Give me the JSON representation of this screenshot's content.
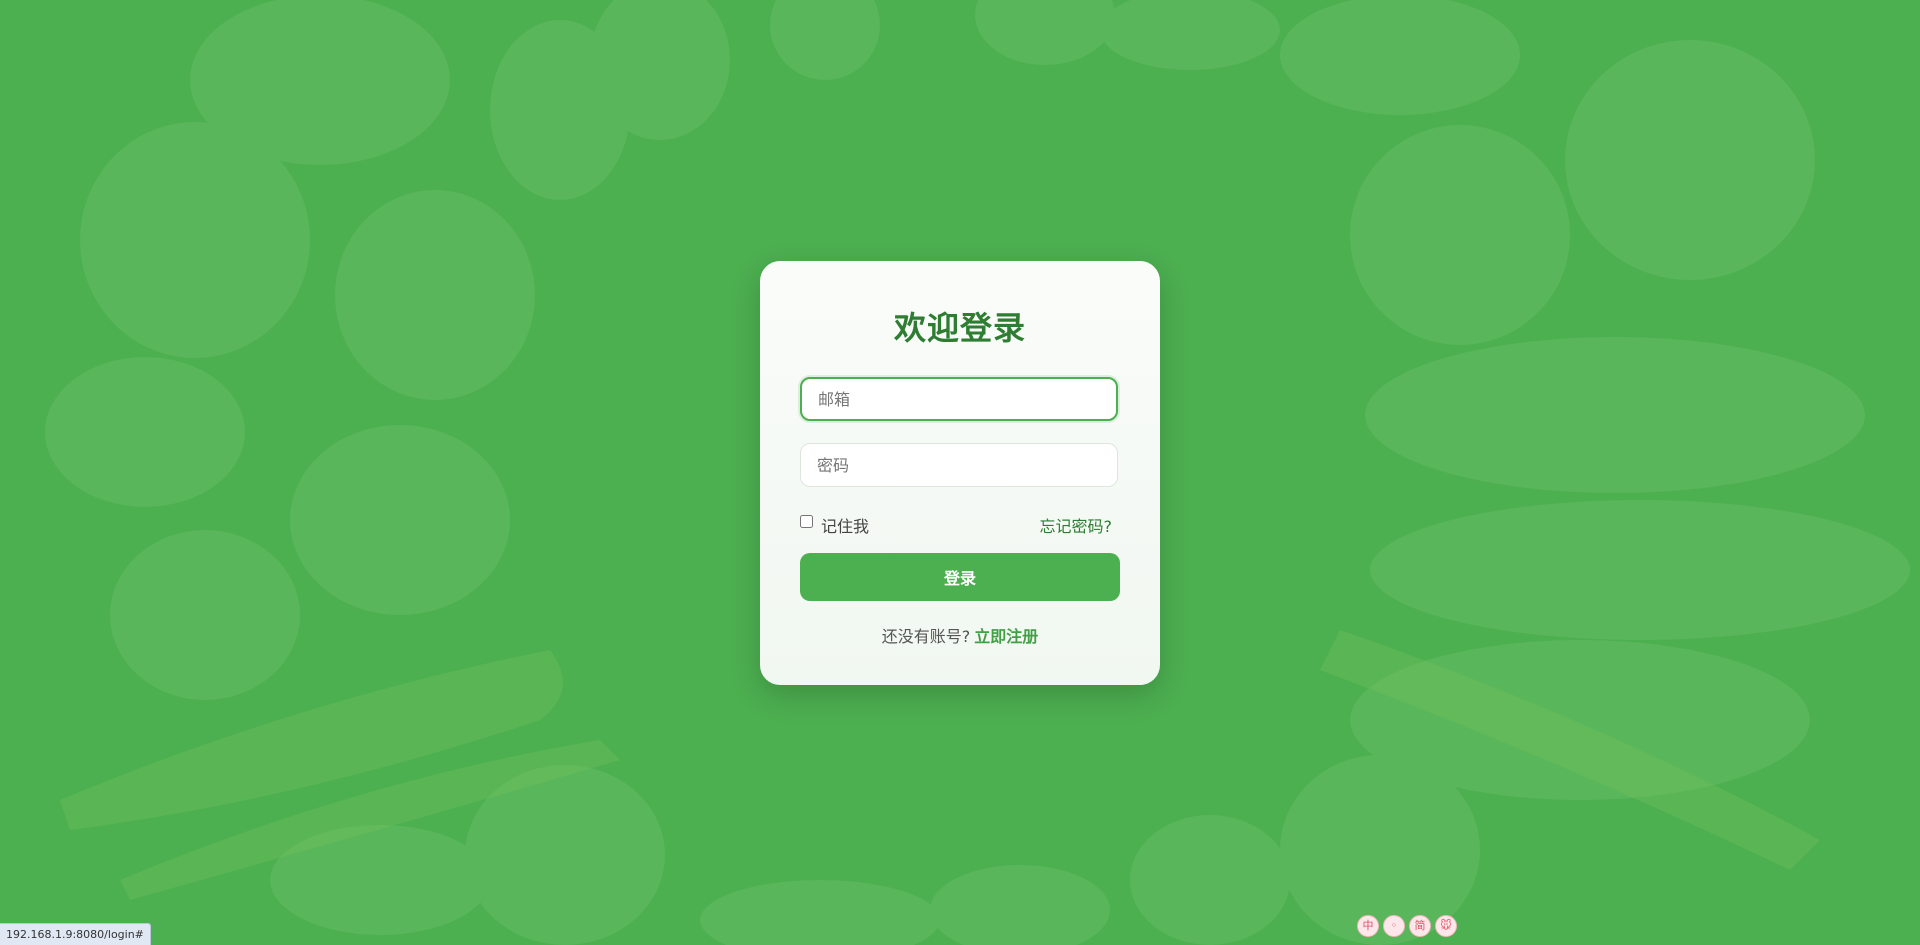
{
  "login": {
    "title": "欢迎登录",
    "email_placeholder": "邮箱",
    "password_placeholder": "密码",
    "remember_label": "记住我",
    "forgot_label": "忘记密码?",
    "submit_label": "登录",
    "register_prompt": "还没有账号?",
    "register_link": "立即注册"
  },
  "status_bar": {
    "url": "192.168.1.9:8080/login#"
  },
  "ime_toolbar": {
    "buttons": [
      {
        "label": "中",
        "icon": "chinese-input-icon"
      },
      {
        "label": "◦",
        "icon": "punctuation-icon"
      },
      {
        "label": "简",
        "icon": "simplified-icon"
      },
      {
        "label": "🐭",
        "icon": "mascot-icon"
      }
    ]
  },
  "colors": {
    "background": "#4caf50",
    "title": "#2e7d32",
    "accent": "#4caf50",
    "link": "#43a047"
  }
}
